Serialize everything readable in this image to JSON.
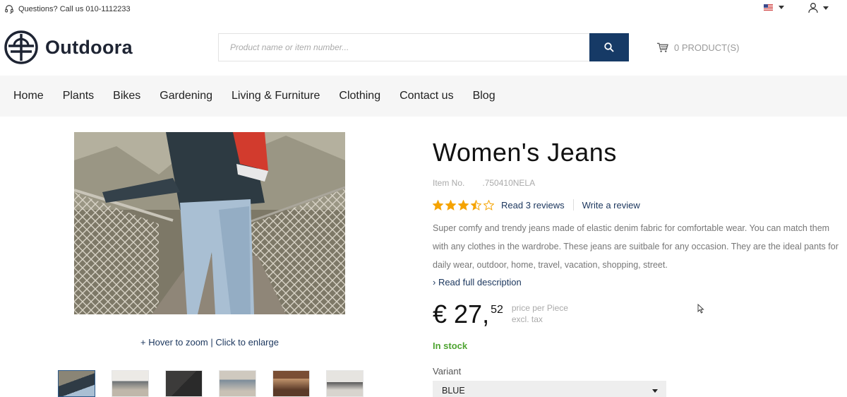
{
  "topbar": {
    "help_text": "Questions? Call us 010-1112233",
    "language_icon": "us-flag-icon"
  },
  "header": {
    "logo_text": "Outdoora",
    "search_placeholder": "Product name or item number...",
    "cart_label": "0 PRODUCT(S)"
  },
  "nav": {
    "items": [
      {
        "label": "Home"
      },
      {
        "label": "Plants"
      },
      {
        "label": "Bikes"
      },
      {
        "label": "Gardening"
      },
      {
        "label": "Living & Furniture"
      },
      {
        "label": "Clothing"
      },
      {
        "label": "Contact us"
      },
      {
        "label": "Blog"
      }
    ]
  },
  "gallery": {
    "zoom_hint_hover": "+ Hover to zoom",
    "zoom_hint_sep": " | ",
    "zoom_hint_click": "Click to enlarge",
    "thumb_count": 6
  },
  "product": {
    "title": "Women's Jeans",
    "item_no_label": "Item No.",
    "item_no_value": ".750410NELA",
    "rating": 3.5,
    "rating_max": 5,
    "read_reviews": "Read 3 reviews",
    "write_review": "Write a review",
    "description": "Super comfy and trendy jeans made of elastic denim fabric for comfortable wear. You can match them with any clothes in the wardrobe. These jeans are suitbale for any occasion. They are the ideal pants for daily wear, outdoor, home, travel, vacation, shopping, street.",
    "read_full": "› Read full description",
    "price_main": "€ 27,",
    "price_cents": "52",
    "price_per": "price per Piece",
    "price_tax": "excl. tax",
    "stock": "In stock",
    "variant_label": "Variant",
    "variant_value": "BLUE"
  },
  "colors": {
    "brand_navy": "#163a66",
    "link": "#1b365d",
    "stock_green": "#4ea431",
    "star": "#f5a300"
  }
}
